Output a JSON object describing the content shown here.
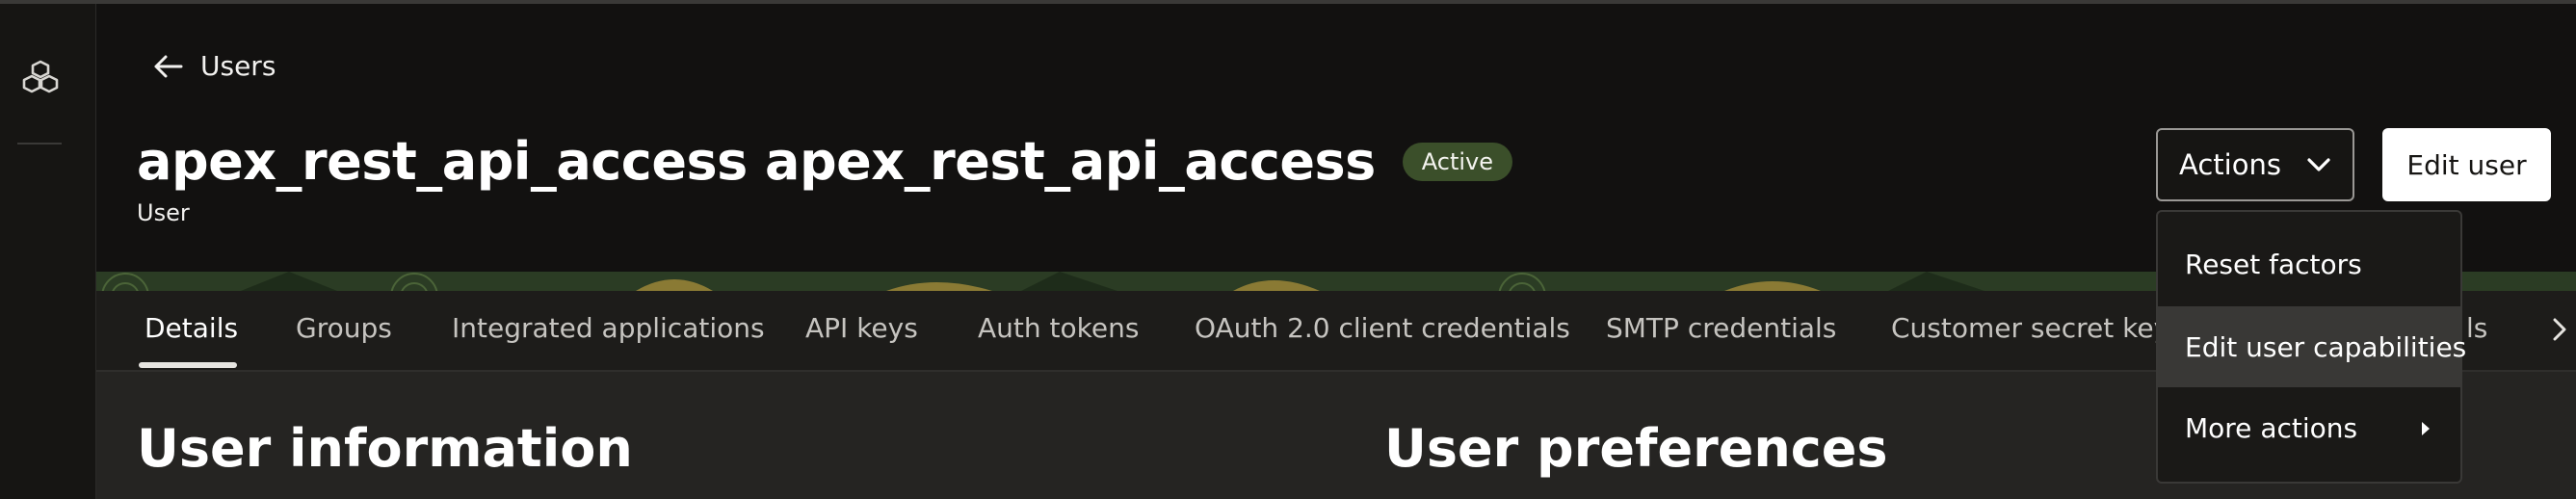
{
  "nav": {
    "back_label": "Users"
  },
  "user": {
    "display_name": "apex_rest_api_access apex_rest_api_access",
    "status": "Active",
    "type_label": "User"
  },
  "header_actions": {
    "actions_label": "Actions",
    "edit_label": "Edit user"
  },
  "actions_menu": {
    "items": [
      {
        "label": "Reset factors"
      },
      {
        "label": "Edit user capabilities"
      },
      {
        "label": "More actions"
      }
    ]
  },
  "tabs": [
    {
      "label": "Details"
    },
    {
      "label": "Groups"
    },
    {
      "label": "Integrated applications"
    },
    {
      "label": "API keys"
    },
    {
      "label": "Auth tokens"
    },
    {
      "label": "OAuth 2.0 client credentials"
    },
    {
      "label": "SMTP credentials"
    },
    {
      "label": "Customer secret keys"
    },
    {
      "label": "ls"
    }
  ],
  "sections": {
    "left_heading": "User information",
    "right_heading": "User preferences"
  },
  "colors": {
    "background": "#161513",
    "status_badge": "#3b4f2a",
    "menu_highlight": "#393836"
  },
  "icons": {
    "rail": "cubes-logo-icon",
    "back": "arrow-left-icon",
    "actions": "chevron-down-icon",
    "submenu": "caret-right-icon",
    "tabs_scroll": "chevron-right-icon"
  }
}
